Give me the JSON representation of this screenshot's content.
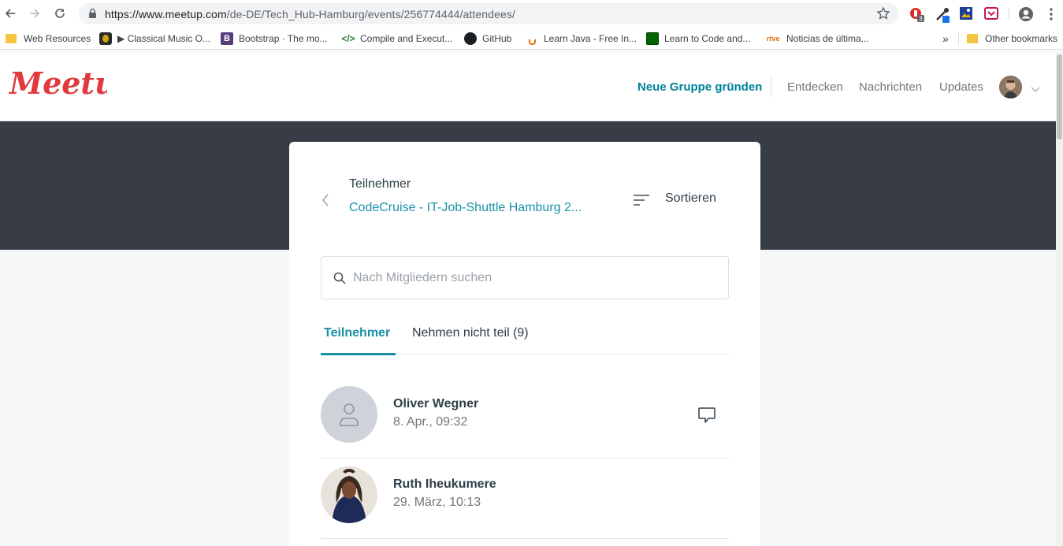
{
  "browser": {
    "url_host": "https://www.meetup.com",
    "url_path": "/de-DE/Tech_Hub-Hamburg/events/256774444/attendees/",
    "extension_badge": "3",
    "bookmarks": [
      {
        "label": "Web Resources",
        "icon": "folder-icon"
      },
      {
        "label": "▶ Classical Music O...",
        "icon": "classical-music-icon"
      },
      {
        "label": "Bootstrap · The mo...",
        "icon": "bootstrap-icon"
      },
      {
        "label": "Compile and Execut...",
        "icon": "code-icon"
      },
      {
        "label": "GitHub",
        "icon": "github-icon"
      },
      {
        "label": "Learn Java - Free In...",
        "icon": "java-icon"
      },
      {
        "label": "Learn to Code and...",
        "icon": "freecodecamp-icon"
      },
      {
        "label": "Noticias de última...",
        "icon": "rtve-icon"
      }
    ],
    "bookmarks_overflow": "»",
    "other_bookmarks": "Other bookmarks",
    "rtve_text": "rtve"
  },
  "header": {
    "logo_text": "Meetup",
    "start_group": "Neue Gruppe gründen",
    "explore": "Entdecken",
    "messages": "Nachrichten",
    "updates": "Updates"
  },
  "card": {
    "label": "Teilnehmer",
    "event_title": "CodeCruise - IT-Job-Shuttle Hamburg 2...",
    "sort_label": "Sortieren",
    "search_placeholder": "Nach Mitgliedern suchen",
    "tabs": {
      "attending": "Teilnehmer",
      "not_attending": "Nehmen nicht teil (9)"
    }
  },
  "members": [
    {
      "name": "Oliver Wegner",
      "date": "8. Apr., 09:32"
    },
    {
      "name": "Ruth Iheukumere",
      "date": "29. März, 10:13"
    }
  ],
  "colors": {
    "brand": "#e0393e",
    "link": "#1a8fa8",
    "band": "#373c47"
  }
}
